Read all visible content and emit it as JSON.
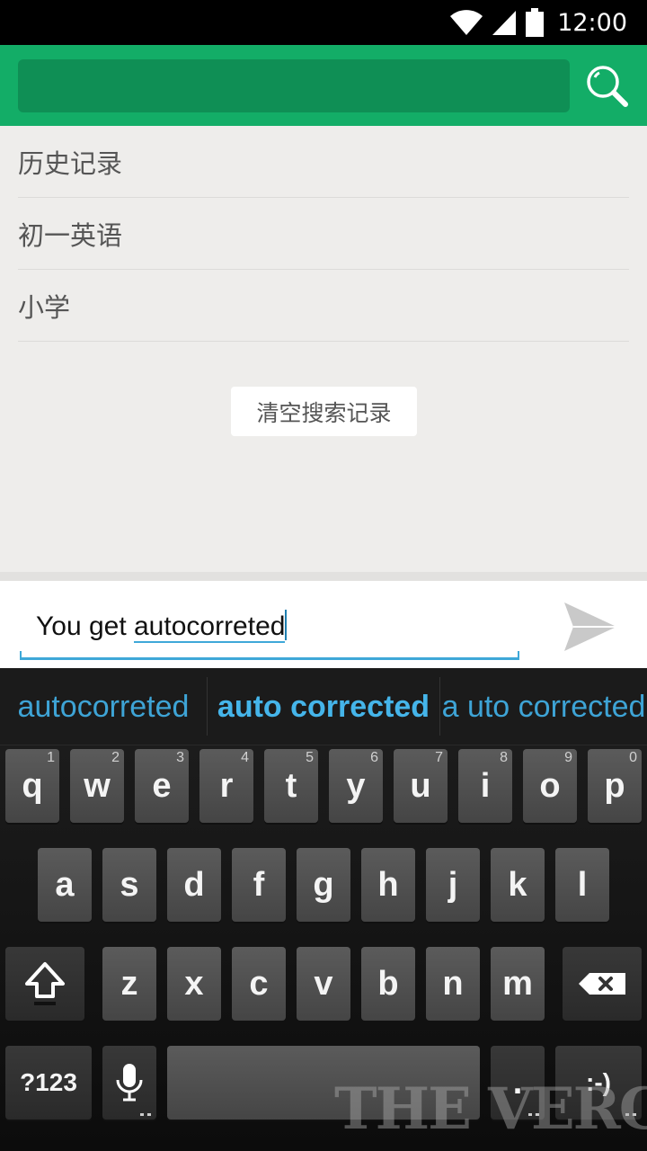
{
  "status_bar": {
    "time": "12:00",
    "icons": [
      "wifi-icon",
      "signal-icon",
      "battery-icon"
    ]
  },
  "header": {
    "search_value": "",
    "search_icon": "search-icon",
    "accent": "#13ad67"
  },
  "history": {
    "title": "历史记录",
    "items": [
      "初一英语",
      "小学"
    ],
    "clear_label": "清空搜索记录"
  },
  "compose": {
    "text_prefix": "You get ",
    "text_underlined": "autocorreted",
    "send_icon": "send-icon"
  },
  "keyboard": {
    "suggestions": [
      "autocorreted",
      "auto corrected",
      "a uto corrected"
    ],
    "row1": [
      {
        "k": "q",
        "h": "1"
      },
      {
        "k": "w",
        "h": "2"
      },
      {
        "k": "e",
        "h": "3"
      },
      {
        "k": "r",
        "h": "4"
      },
      {
        "k": "t",
        "h": "5"
      },
      {
        "k": "y",
        "h": "6"
      },
      {
        "k": "u",
        "h": "7"
      },
      {
        "k": "i",
        "h": "8"
      },
      {
        "k": "o",
        "h": "9"
      },
      {
        "k": "p",
        "h": "0"
      }
    ],
    "row2": [
      "a",
      "s",
      "d",
      "f",
      "g",
      "h",
      "j",
      "k",
      "l"
    ],
    "row3": [
      "z",
      "x",
      "c",
      "v",
      "b",
      "n",
      "m"
    ],
    "symbols_label": "?123",
    "period_label": ".",
    "smiley_label": ":-)",
    "watermark": "THE VERGE"
  }
}
